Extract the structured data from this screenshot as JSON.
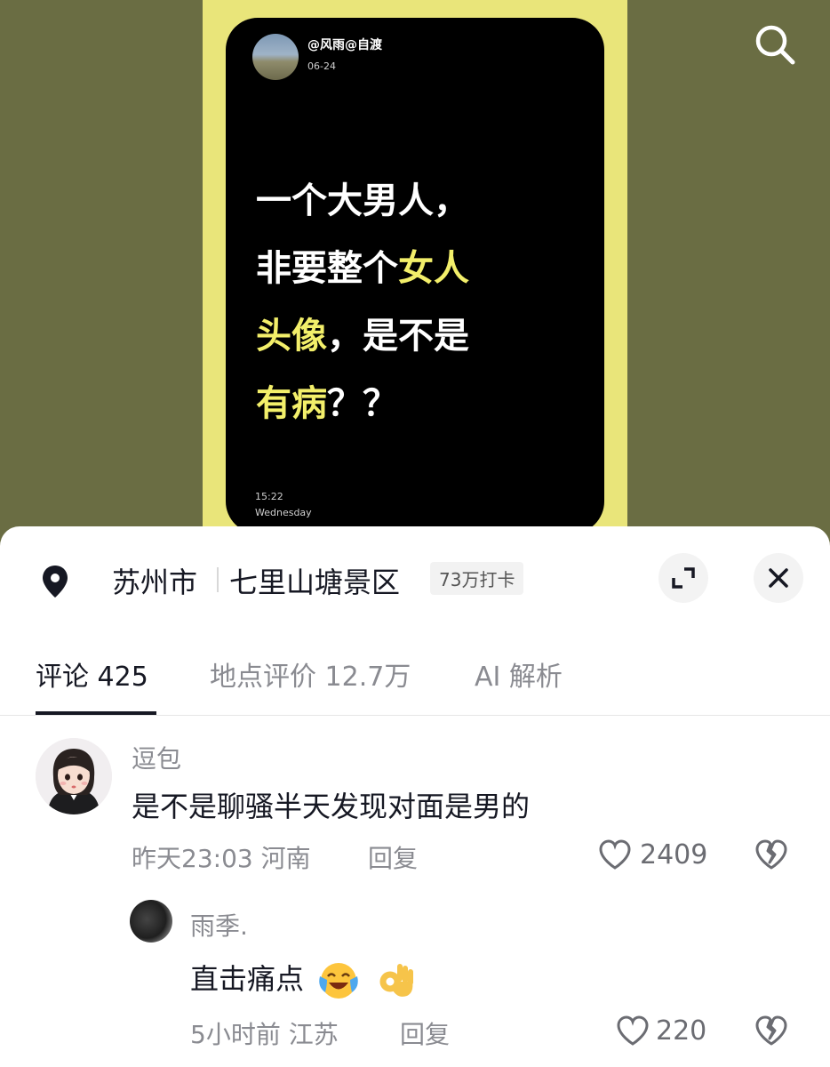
{
  "post": {
    "username": "@风雨@自渡",
    "date": "06-24",
    "text_line1": "一个大男人，",
    "text_line2_a": "非要整个",
    "text_line2_b": "女人",
    "text_line3_a": "头像",
    "text_line3_b": "，是不是",
    "text_line4_a": "有病",
    "text_line4_b": "？？",
    "time": "15:22",
    "weekday": "Wednesday",
    "highlight_color": "#f3ef6a"
  },
  "location": {
    "city": "苏州市",
    "place": "七里山塘景区",
    "checkins": "73万打卡"
  },
  "tabs": {
    "comments": "评论 425",
    "reviews": "地点评价 12.7万",
    "ai": "AI 解析"
  },
  "comments": [
    {
      "user": "逗包",
      "text": "是不是聊骚半天发现对面是男的",
      "meta": "昨天23:03  河南",
      "reply": "回复",
      "likes": "2409"
    },
    {
      "user": "雨季.",
      "text": "直击痛点",
      "emojis": [
        "laughing-crying",
        "ok-hand"
      ],
      "meta": "5小时前  江苏",
      "reply": "回复",
      "likes": "220"
    }
  ],
  "icons": {
    "search": "search-icon",
    "location": "location-pin-icon",
    "expand": "expand-icon",
    "close": "close-icon",
    "like": "heart-icon",
    "dislike": "broken-heart-icon"
  }
}
